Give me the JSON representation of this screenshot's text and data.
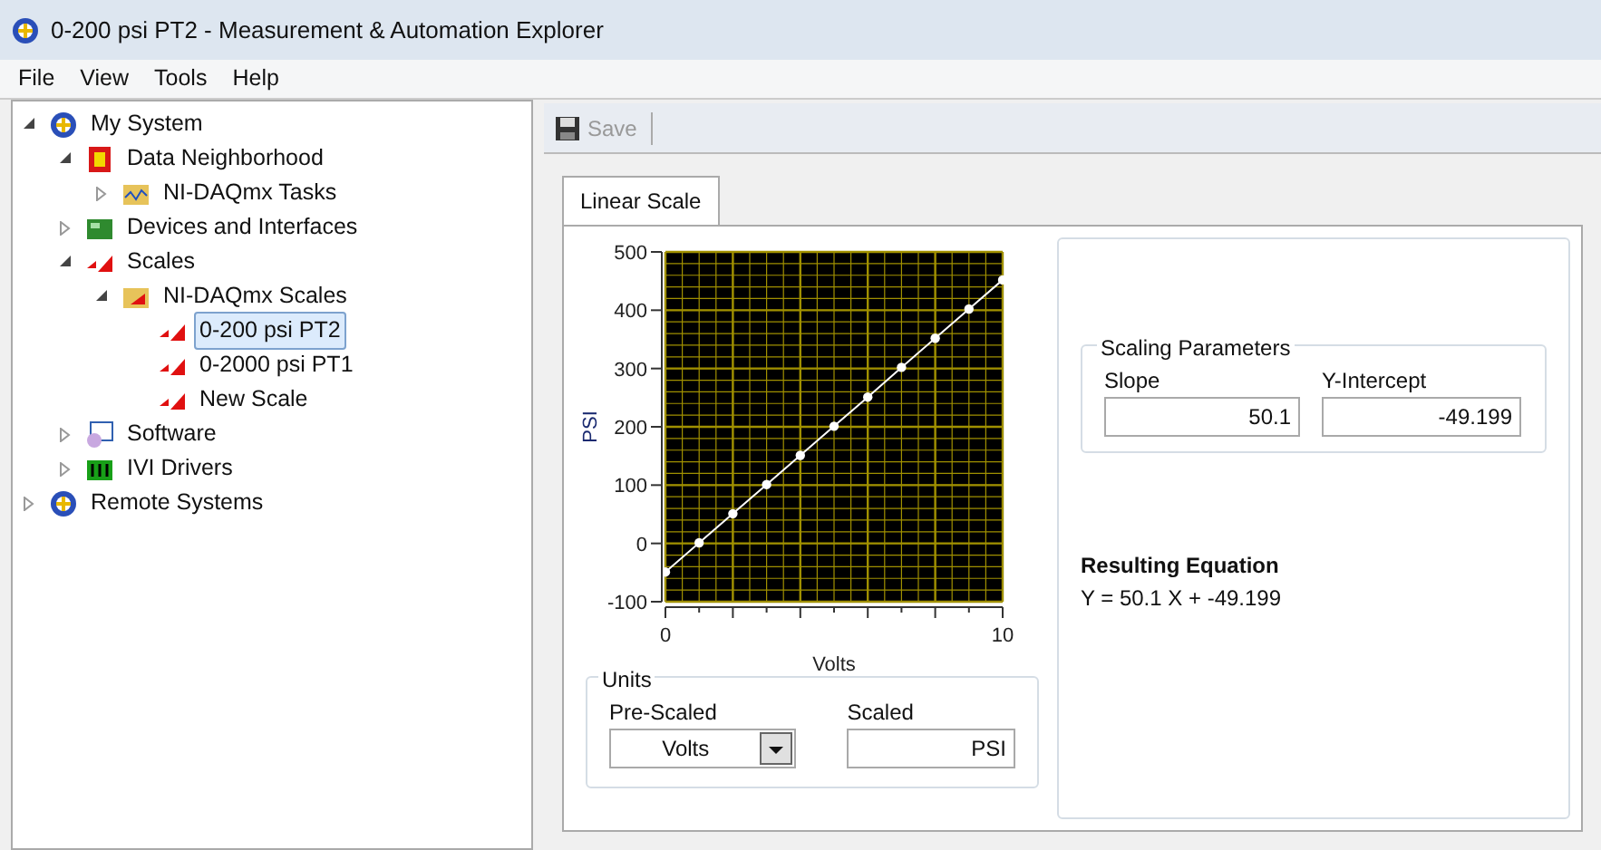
{
  "window": {
    "title": "0-200 psi PT2 - Measurement & Automation Explorer"
  },
  "menu": [
    "File",
    "View",
    "Tools",
    "Help"
  ],
  "tree": [
    {
      "label": "My System",
      "kind": "system",
      "expanded": true,
      "selected": false,
      "children": [
        {
          "label": "Data Neighborhood",
          "kind": "neighborhood",
          "expanded": true,
          "selected": false,
          "children": [
            {
              "label": "NI-DAQmx Tasks",
              "kind": "tasks",
              "expanded": false,
              "selected": false
            }
          ]
        },
        {
          "label": "Devices and Interfaces",
          "kind": "devices",
          "expanded": false,
          "selected": false
        },
        {
          "label": "Scales",
          "kind": "scales",
          "expanded": true,
          "selected": false,
          "children": [
            {
              "label": "NI-DAQmx Scales",
              "kind": "folder",
              "expanded": true,
              "selected": false,
              "children": [
                {
                  "label": "0-200 psi PT2",
                  "kind": "scale",
                  "selected": true
                },
                {
                  "label": "0-2000 psi PT1",
                  "kind": "scale",
                  "selected": false
                },
                {
                  "label": "New Scale",
                  "kind": "scale",
                  "selected": false
                }
              ]
            }
          ]
        },
        {
          "label": "Software",
          "kind": "software",
          "expanded": false,
          "selected": false
        },
        {
          "label": "IVI Drivers",
          "kind": "ivi",
          "expanded": false,
          "selected": false
        }
      ]
    },
    {
      "label": "Remote Systems",
      "kind": "system",
      "expanded": false,
      "selected": false
    }
  ],
  "toolbar": {
    "save": {
      "label": "Save",
      "disabled": true
    }
  },
  "tabs": [
    {
      "label": "Linear Scale",
      "selected": true
    }
  ],
  "chart": {
    "chart_data": {
      "type": "line",
      "xlabel": "Volts",
      "ylabel": "PSI",
      "xlim": [
        0,
        10
      ],
      "ylim": [
        -100,
        500
      ],
      "xticks": [
        0,
        10
      ],
      "yticks": [
        -100,
        0,
        100,
        200,
        300,
        400,
        500
      ],
      "x": [
        0,
        1,
        2,
        3,
        4,
        5,
        6,
        7,
        8,
        9,
        10
      ],
      "grid": true,
      "series": [
        {
          "color": "#ffffff",
          "marker": "circle",
          "values": [
            -49,
            1,
            51,
            101,
            151,
            201,
            251,
            302,
            352,
            402,
            452
          ]
        }
      ]
    }
  },
  "units": {
    "title": "Units",
    "pre_scaled": {
      "label": "Pre-Scaled",
      "value": "Volts"
    },
    "scaled": {
      "label": "Scaled",
      "value": "PSI"
    }
  },
  "scaling": {
    "title": "Scaling Parameters",
    "slope": {
      "label": "Slope",
      "value": "50.1"
    },
    "intercept": {
      "label": "Y-Intercept",
      "value": "-49.199"
    }
  },
  "equation": {
    "title": "Resulting Equation",
    "text": "Y = 50.1 X + -49.199"
  }
}
